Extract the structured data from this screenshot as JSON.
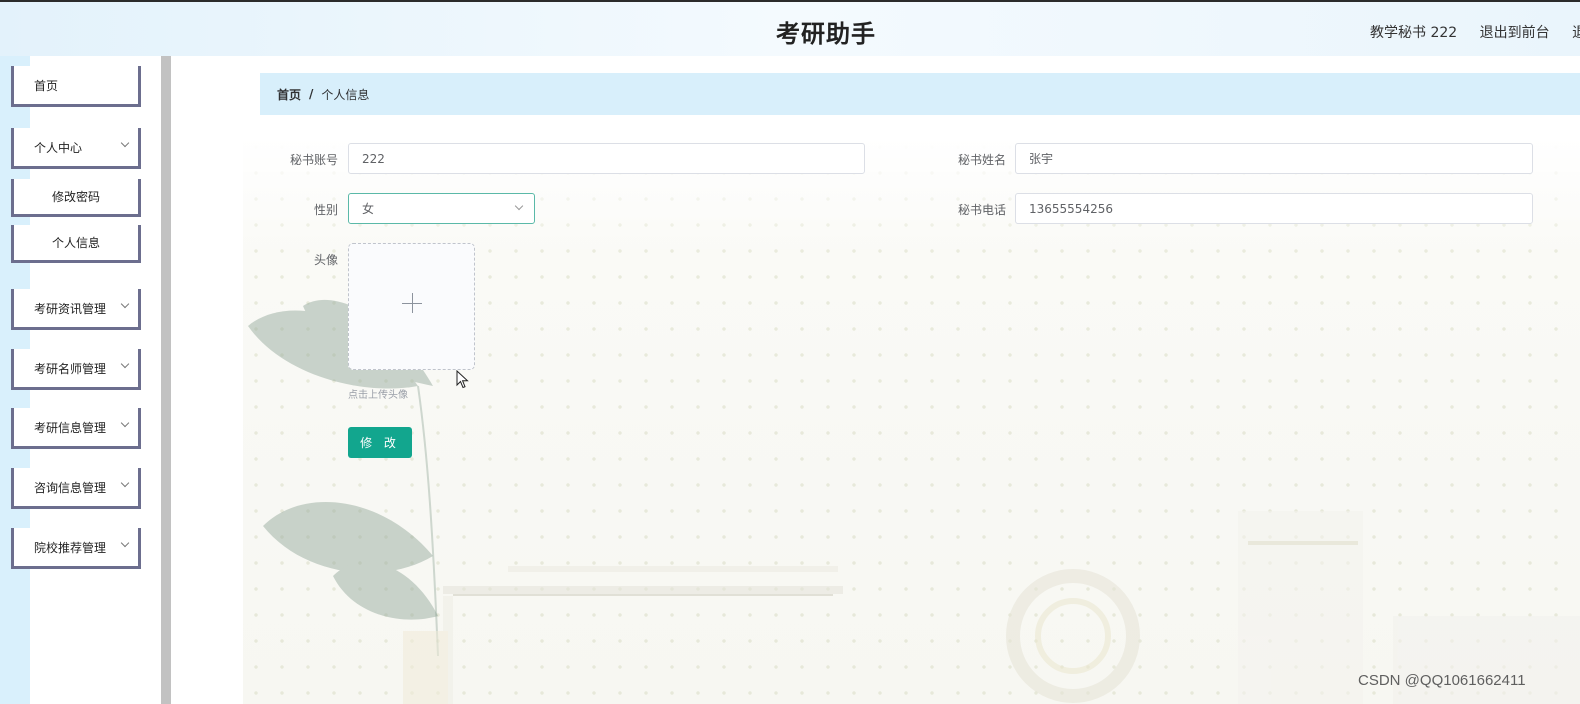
{
  "header": {
    "title": "考研助手",
    "user_label": "教学秘书 222",
    "front_link": "退出到前台",
    "logout_link": "退"
  },
  "sidebar": {
    "items": [
      {
        "label": "首页",
        "has_arrow": false
      },
      {
        "label": "个人中心",
        "has_arrow": true
      },
      {
        "label": "修改密码",
        "sub": true
      },
      {
        "label": "个人信息",
        "sub": true
      },
      {
        "label": "考研资讯管理",
        "has_arrow": true
      },
      {
        "label": "考研名师管理",
        "has_arrow": true
      },
      {
        "label": "考研信息管理",
        "has_arrow": true
      },
      {
        "label": "咨询信息管理",
        "has_arrow": true
      },
      {
        "label": "院校推荐管理",
        "has_arrow": true
      }
    ]
  },
  "breadcrumb": {
    "home": "首页",
    "separator": "/",
    "current": "个人信息"
  },
  "form": {
    "account_label": "秘书账号",
    "account_value": "222",
    "name_label": "秘书姓名",
    "name_value": "张宇",
    "gender_label": "性别",
    "gender_value": "女",
    "phone_label": "秘书电话",
    "phone_value": "13655554256",
    "avatar_label": "头像",
    "upload_tip": "点击上传头像",
    "submit_label": "修 改"
  },
  "watermark": "CSDN @QQ1061662411",
  "colors": {
    "accent": "#12a68e",
    "breadcrumb_bg": "#d8effb",
    "sidebar_border": "#6c6e8e"
  }
}
